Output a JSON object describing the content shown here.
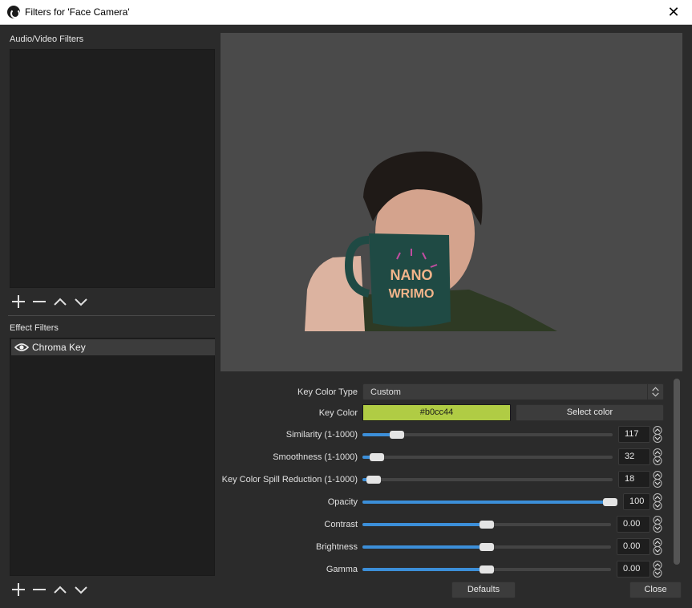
{
  "window": {
    "title": "Filters for 'Face Camera'"
  },
  "av_filters": {
    "label": "Audio/Video Filters"
  },
  "effect_filters": {
    "label": "Effect Filters",
    "items": [
      {
        "label": "Chroma Key",
        "visible": true
      }
    ]
  },
  "properties": {
    "key_color_type": {
      "label": "Key Color Type",
      "value": "Custom"
    },
    "key_color": {
      "label": "Key Color",
      "value": "#b0cc44",
      "button": "Select color"
    },
    "similarity": {
      "label": "Similarity (1-1000)",
      "value": "117",
      "fraction": 0.117
    },
    "smoothness": {
      "label": "Smoothness (1-1000)",
      "value": "32",
      "fraction": 0.032
    },
    "spill": {
      "label": "Key Color Spill Reduction (1-1000)",
      "value": "18",
      "fraction": 0.018
    },
    "opacity": {
      "label": "Opacity",
      "value": "100",
      "fraction": 1.0
    },
    "contrast": {
      "label": "Contrast",
      "value": "0.00",
      "fraction": 0.5
    },
    "brightness": {
      "label": "Brightness",
      "value": "0.00",
      "fraction": 0.5
    },
    "gamma": {
      "label": "Gamma",
      "value": "0.00",
      "fraction": 0.5
    }
  },
  "footer": {
    "defaults": "Defaults",
    "close": "Close"
  },
  "mug_text": {
    "line1": "NANO",
    "line2": "WRIMO"
  },
  "colors": {
    "accent": "#3c8fd9",
    "key_color": "#b0cc44"
  }
}
